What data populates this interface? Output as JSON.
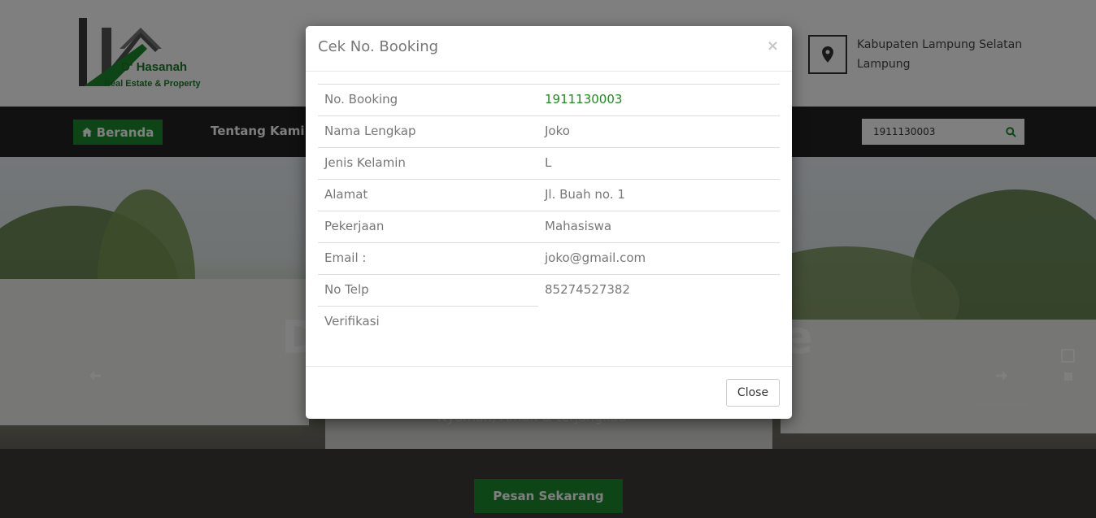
{
  "header": {
    "logo_name": "D' Hasanah",
    "logo_tagline": "Real Estate & Property",
    "location_line1": "Kabupaten Lampung Selatan",
    "location_line2": "Lampung"
  },
  "nav": {
    "home_label": "Beranda",
    "about_label": "Tentang Kami",
    "search_value": "1911130003"
  },
  "hero": {
    "title_left": "D",
    "title_right": "e",
    "subtitle": "Nyaman, Aman & terjangkau",
    "cta_label": "Pesan Sekarang"
  },
  "modal": {
    "title": "Cek No. Booking",
    "close_x": "×",
    "close_button": "Close",
    "rows": [
      {
        "label": "No. Booking",
        "value": "1911130003"
      },
      {
        "label": "Nama Lengkap",
        "value": "Joko"
      },
      {
        "label": "Jenis Kelamin",
        "value": "L"
      },
      {
        "label": "Alamat",
        "value": "Jl. Buah no. 1"
      },
      {
        "label": "Pekerjaan",
        "value": "Mahasiswa"
      },
      {
        "label": "Email :",
        "value": "joko@gmail.com"
      },
      {
        "label": "No Telp",
        "value": "85274527382"
      },
      {
        "label": "Verifikasi",
        "value": ""
      }
    ]
  },
  "colors": {
    "brand_green": "#1d8a2e",
    "booking_number_green": "#1e8b1f",
    "navbar_dark": "#222222"
  },
  "icons": {
    "home": "home-icon",
    "search": "search-icon",
    "location": "map-pin-icon",
    "prev": "arrow-left-icon",
    "next": "arrow-right-icon"
  }
}
